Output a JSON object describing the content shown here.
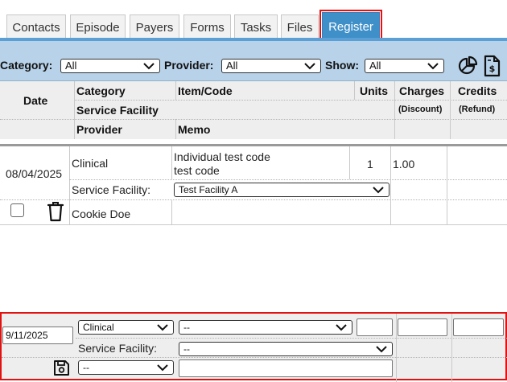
{
  "tabs": [
    {
      "label": "Contacts",
      "active": false
    },
    {
      "label": "Episode",
      "active": false
    },
    {
      "label": "Payers",
      "active": false
    },
    {
      "label": "Forms",
      "active": false
    },
    {
      "label": "Tasks",
      "active": false
    },
    {
      "label": "Files",
      "active": false
    },
    {
      "label": "Register",
      "active": true
    }
  ],
  "filters": {
    "category_label": "Category:",
    "category_value": "All",
    "provider_label": "Provider:",
    "provider_value": "All",
    "show_label": "Show:",
    "show_value": "All",
    "chart_icon": "pie-chart-icon",
    "invoice_icon": "invoice-dollar-icon"
  },
  "columns": {
    "date": "Date",
    "category": "Category",
    "item_code": "Item/Code",
    "units": "Units",
    "charges": "Charges",
    "credits": "Credits",
    "service_facility": "Service Facility",
    "discount": "(Discount)",
    "refund": "(Refund)",
    "provider": "Provider",
    "memo": "Memo"
  },
  "record": {
    "date": "08/04/2025",
    "category": "Clinical",
    "item_line1": "Individual test code",
    "item_line2": "test code",
    "units": "1",
    "charges": "1.00",
    "service_facility_label": "Service Facility:",
    "service_facility_value": "Test Facility A",
    "provider": "Cookie Doe",
    "delete_icon": "trash-icon"
  },
  "new_entry": {
    "date": "9/11/2025",
    "category_value": "Clinical",
    "item_value": "--",
    "units_value": "",
    "charges_value": "",
    "credits_value": "",
    "service_facility_label": "Service Facility:",
    "service_facility_value": "--",
    "provider_value": "--",
    "memo_value": "",
    "save_icon": "save-icon"
  },
  "colors": {
    "active_tab": "#3f8fc9",
    "filter_bar": "#b8d2e9",
    "highlight": "#e21212"
  }
}
